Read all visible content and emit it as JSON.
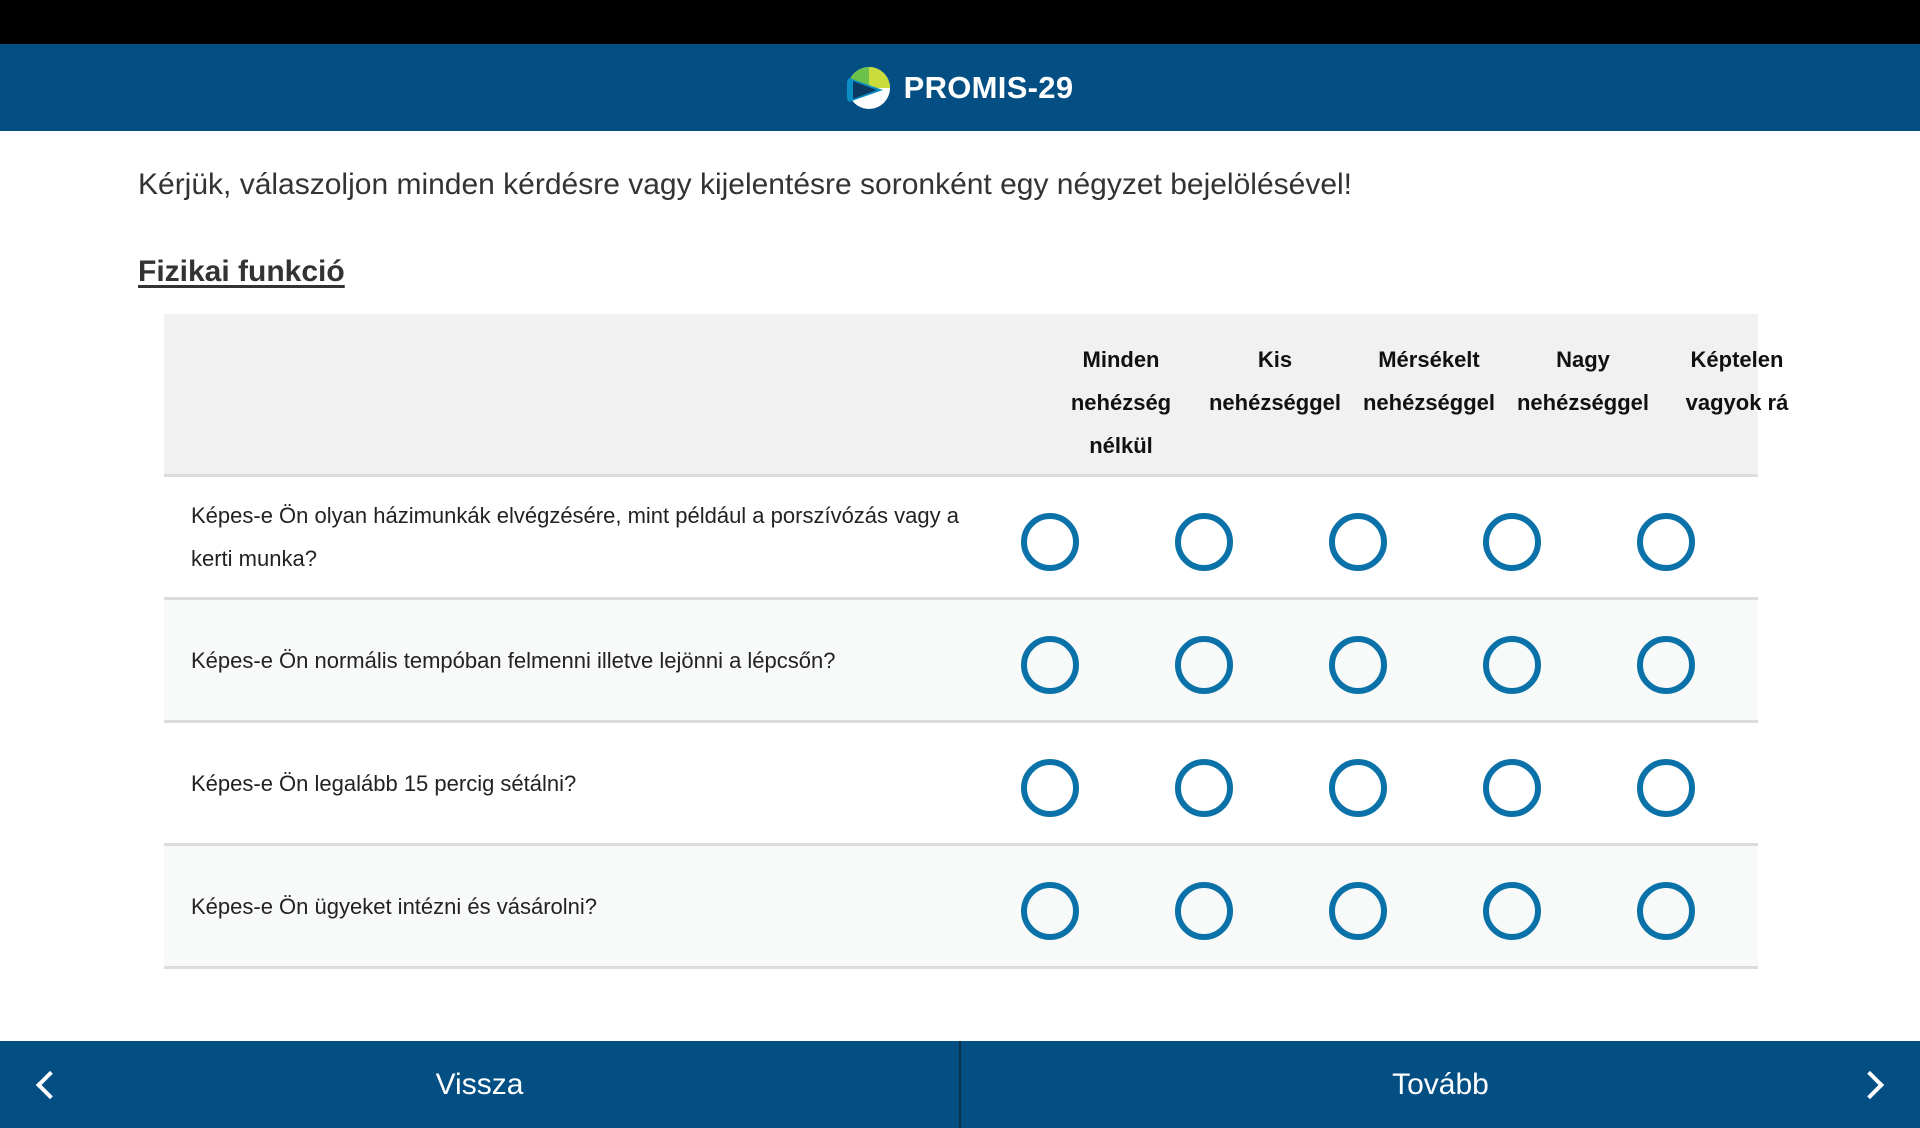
{
  "app": {
    "title": "PROMIS-29",
    "logo_icon": "promis-logo-icon",
    "brand_color": "#034f84",
    "radio_color": "#0a72a8"
  },
  "instructions": "Kérjük, válaszoljon minden kérdésre vagy kijelentésre soronként egy négyzet bejelölésével!",
  "section_title": "Fizikai funkció",
  "columns": [
    {
      "line1": "Minden",
      "line2": "nehézség",
      "line3": "nélkül"
    },
    {
      "line1": "Kis",
      "line2": "nehézséggel",
      "line3": ""
    },
    {
      "line1": "Mérsékelt",
      "line2": "nehézséggel",
      "line3": ""
    },
    {
      "line1": "Nagy",
      "line2": "nehézséggel",
      "line3": ""
    },
    {
      "line1": "Képtelen",
      "line2": "vagyok rá",
      "line3": ""
    }
  ],
  "questions": [
    {
      "text": "Képes-e Ön olyan házimunkák elvégzésére, mint például a porszívózás vagy a kerti munka?",
      "selected": null
    },
    {
      "text": "Képes-e Ön normális tempóban felmenni illetve lejönni a lépcsőn?",
      "selected": null
    },
    {
      "text": "Képes-e Ön legalább 15 percig sétálni?",
      "selected": null
    },
    {
      "text": "Képes-e Ön ügyeket intézni és vásárolni?",
      "selected": null
    }
  ],
  "footer": {
    "back_label": "Vissza",
    "next_label": "Tovább",
    "back_icon": "chevron-left-icon",
    "next_icon": "chevron-right-icon"
  }
}
